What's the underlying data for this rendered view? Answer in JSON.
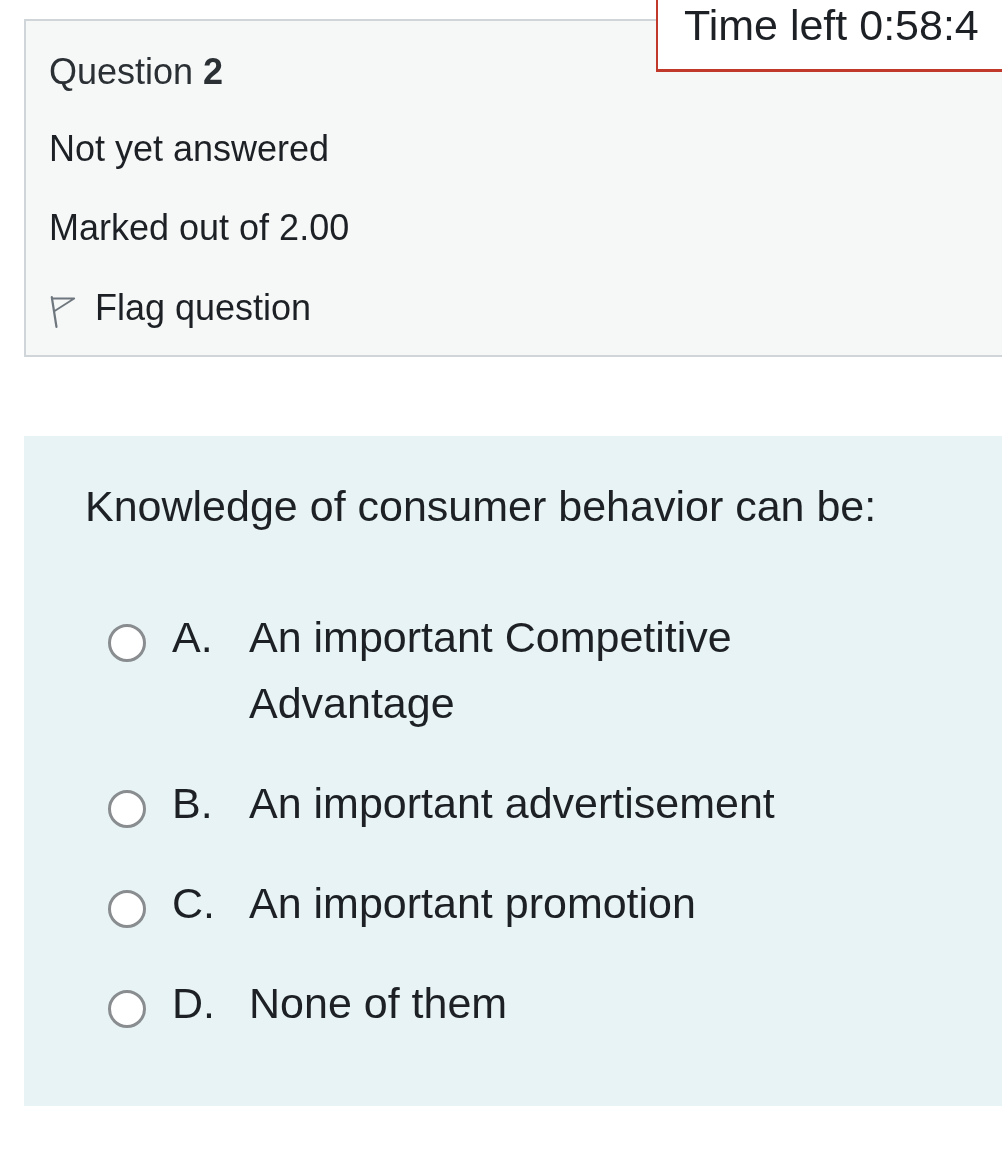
{
  "timer": {
    "text": "Time left 0:58:4"
  },
  "info": {
    "question": "Question **2**",
    "status": "Not yet answered",
    "mark": "Marked out of 2.00",
    "flag": {
      "label": "Flag question",
      "flagged": false
    }
  },
  "question": {
    "prompt": "Knowledge of consumer behavior can be:",
    "options": [
      {
        "letter": "A.",
        "text": "An important Competitive Advantage",
        "selected": false
      },
      {
        "letter": "B.",
        "text": "An important advertisement",
        "selected": false
      },
      {
        "letter": "C.",
        "text": "An important promotion",
        "selected": false
      },
      {
        "letter": "D.",
        "text": "None of them",
        "selected": false
      }
    ]
  }
}
